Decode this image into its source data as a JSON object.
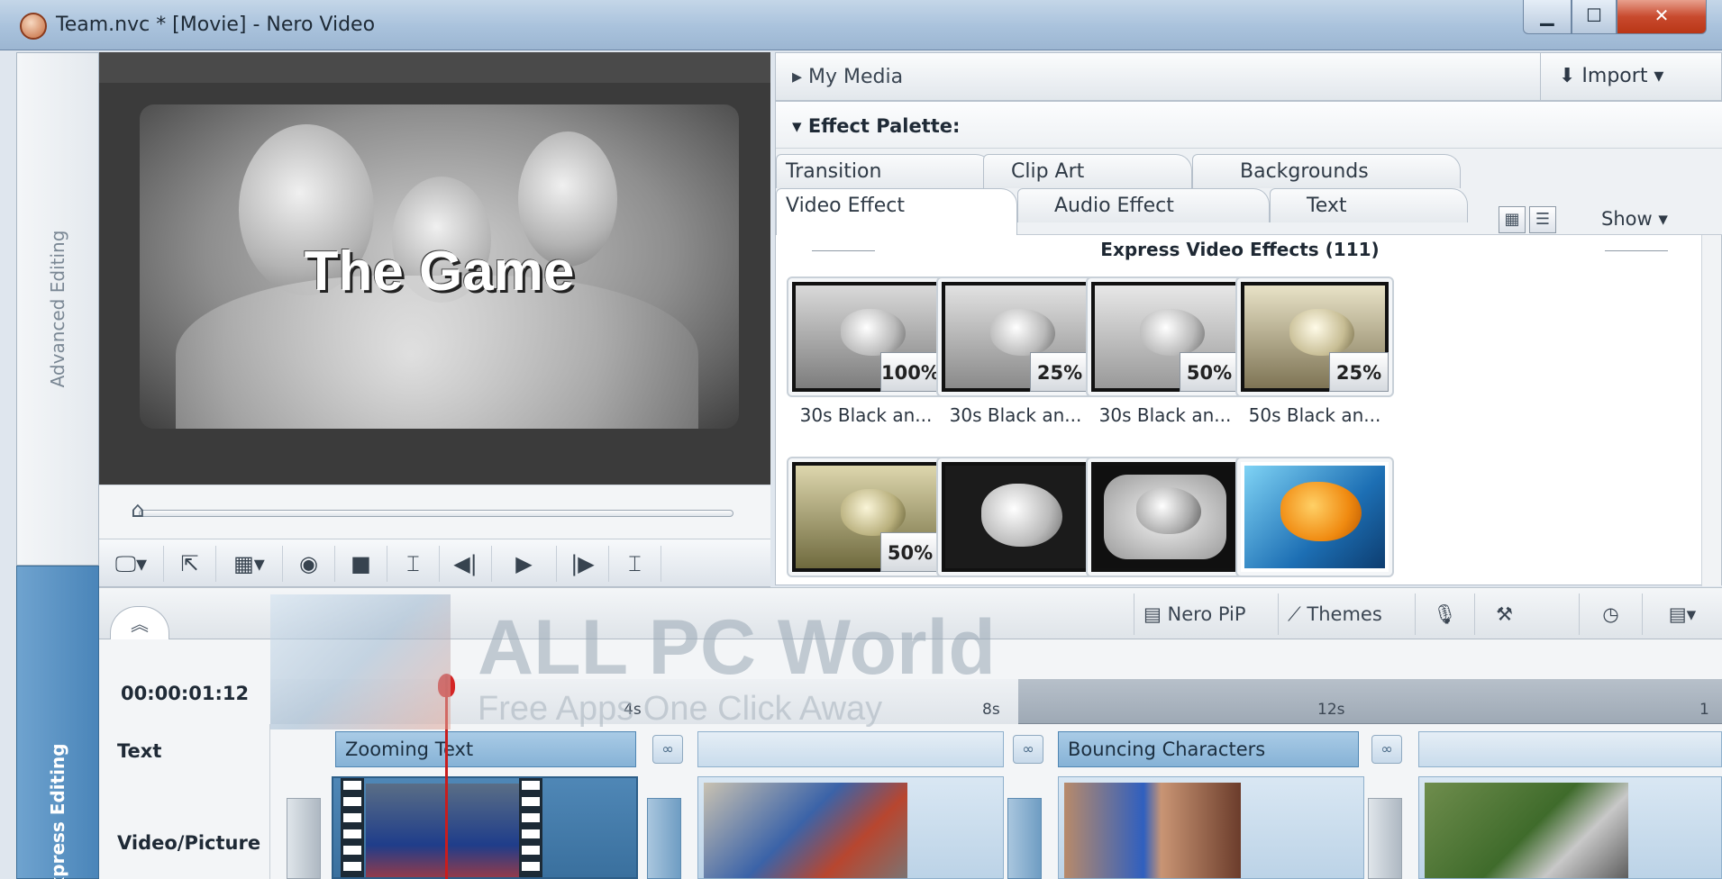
{
  "window": {
    "title": "Team.nvc * [Movie] - Nero Video",
    "controls": {
      "minimize": "▁",
      "maximize": "☐",
      "close": "✕"
    }
  },
  "side_tabs": {
    "advanced": "Advanced Editing",
    "express": "xpress Editing"
  },
  "preview": {
    "overlay_title": "The Game"
  },
  "transport_icons": [
    "monitor-menu-icon",
    "export-frame-icon",
    "display-mode-icon",
    "snapshot-icon",
    "stop-icon",
    "mark-in-icon",
    "previous-frame-icon",
    "play-icon",
    "next-frame-icon",
    "mark-out-icon"
  ],
  "media": {
    "label": "▸ My Media",
    "import": "⬇ Import ▾"
  },
  "palette": {
    "title": "▾ Effect Palette:",
    "tabs_row1": [
      "Transition",
      "Clip Art",
      "Backgrounds"
    ],
    "tabs_row2": [
      "Video Effect",
      "Audio Effect",
      "Text"
    ],
    "active_tab": "Video Effect",
    "show": "Show ▾",
    "section_title": "Express Video Effects (111)",
    "effects": [
      {
        "label": "30s Black an...",
        "badge": "100%",
        "style": "bw"
      },
      {
        "label": "30s Black an...",
        "badge": "25%",
        "style": "bw"
      },
      {
        "label": "30s Black an...",
        "badge": "50%",
        "style": "bw"
      },
      {
        "label": "50s Black an...",
        "badge": "25%",
        "style": "sepia"
      },
      {
        "label": "",
        "badge": "50%",
        "style": "sepia"
      },
      {
        "label": "",
        "badge": "",
        "style": "bw-fish"
      },
      {
        "label": "",
        "badge": "",
        "style": "bw-fish-tv"
      },
      {
        "label": "",
        "badge": "",
        "style": "color-fish"
      }
    ]
  },
  "tools": {
    "pip": "Nero PiP",
    "themes": "Themes"
  },
  "timeline": {
    "timecode": "00:00:01:12",
    "ticks": [
      "4s",
      "8s",
      "12s",
      "1"
    ],
    "tracks": {
      "text": "Text",
      "video": "Video/Picture"
    },
    "text_clips": [
      "Zooming Text",
      "",
      "Bouncing Characters",
      ""
    ]
  },
  "watermark": {
    "main": "ALL PC World",
    "sub": "Free Apps One Click Away"
  }
}
